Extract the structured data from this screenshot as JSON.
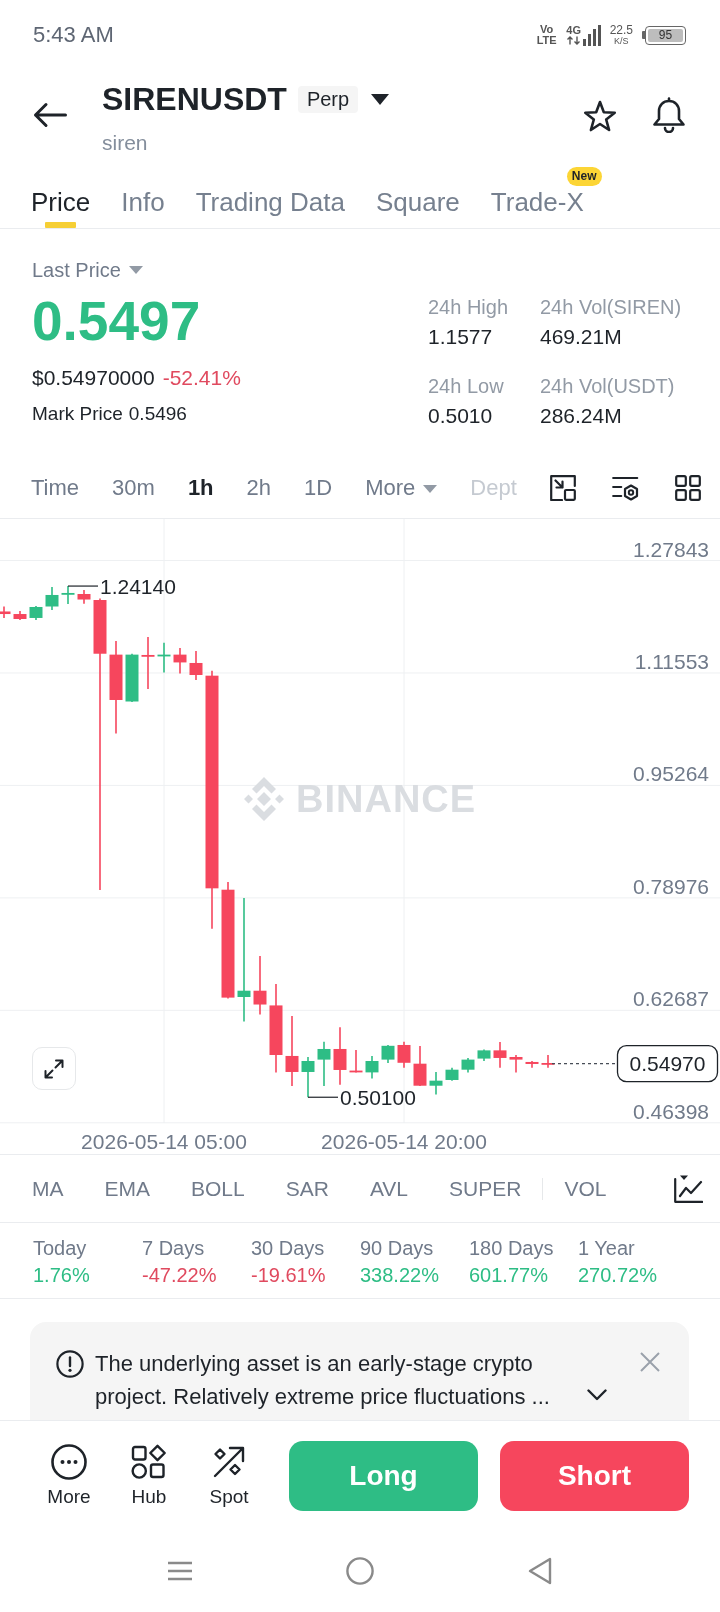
{
  "status_bar": {
    "time": "5:43 AM",
    "volte_top": "Vo",
    "volte_bottom": "LTE",
    "network": "4G",
    "speed": "22.5",
    "speed_unit": "K/S",
    "battery": "95"
  },
  "header": {
    "symbol": "SIRENUSDT",
    "contract": "Perp",
    "name": "siren"
  },
  "tabs": [
    {
      "label": "Price",
      "selected": true
    },
    {
      "label": "Info",
      "selected": false
    },
    {
      "label": "Trading Data",
      "selected": false
    },
    {
      "label": "Square",
      "selected": false
    },
    {
      "label": "Trade-X",
      "selected": false,
      "badge": "New"
    }
  ],
  "ticker": {
    "price_label": "Last Price",
    "last_price": "0.5497",
    "last_price_up": true,
    "usd_price": "$0.54970000",
    "change": "-52.41%",
    "change_up": false,
    "mark_label": "Mark Price",
    "mark_price": "0.5496"
  },
  "stats": [
    {
      "label": "24h High",
      "value": "1.1577"
    },
    {
      "label": "24h Vol(SIREN)",
      "value": "469.21M"
    },
    {
      "label": "24h Low",
      "value": "0.5010"
    },
    {
      "label": "24h Vol(USDT)",
      "value": "286.24M"
    }
  ],
  "intervals": [
    {
      "label": "Time",
      "selected": false
    },
    {
      "label": "30m",
      "selected": false
    },
    {
      "label": "1h",
      "selected": true
    },
    {
      "label": "2h",
      "selected": false
    },
    {
      "label": "1D",
      "selected": false
    }
  ],
  "more_menu": {
    "label": "More"
  },
  "depth_tab": {
    "label": "Dept"
  },
  "chart": {
    "watermark": "BINANCE",
    "chart_data": {
      "type": "candlestick",
      "categories": [
        null,
        null,
        null,
        null,
        null,
        null,
        null,
        null,
        null,
        null,
        "2026-05-14 05:00",
        null,
        null,
        null,
        null,
        null,
        null,
        null,
        null,
        null,
        null,
        null,
        null,
        null,
        null,
        "2026-05-14 20:00",
        null,
        null,
        null,
        null,
        null,
        null,
        null,
        null,
        null
      ],
      "ohlc": [
        [
          1.2046,
          1.2118,
          1.1952,
          1.2009
        ],
        [
          1.2009,
          1.2053,
          1.1923,
          1.1937
        ],
        [
          1.1952,
          1.2125,
          1.1923,
          1.2111
        ],
        [
          1.2118,
          1.24,
          1.2067,
          1.2285
        ],
        [
          1.2292,
          1.2414,
          1.2154,
          1.2314
        ],
        [
          1.2299,
          1.2357,
          1.2159,
          1.2219
        ],
        [
          1.2212,
          1.2233,
          0.8012,
          1.1434
        ],
        [
          1.1421,
          1.1618,
          1.0277,
          1.0764
        ],
        [
          1.0742,
          1.1434,
          1.0735,
          1.1421
        ],
        [
          1.1416,
          1.1676,
          1.0923,
          1.1394
        ],
        [
          1.1401,
          1.1594,
          1.1162,
          1.1421
        ],
        [
          1.1421,
          1.1517,
          1.1148,
          1.1308
        ],
        [
          1.13,
          1.1474,
          1.1054,
          1.1126
        ],
        [
          1.1116,
          1.1188,
          0.7451,
          0.8036
        ],
        [
          0.8016,
          0.8128,
          0.644,
          0.6453
        ],
        [
          0.6462,
          0.7896,
          0.6107,
          0.6553
        ],
        [
          0.6553,
          0.7056,
          0.6207,
          0.6353
        ],
        [
          0.634,
          0.665,
          0.537,
          0.5622
        ],
        [
          0.5608,
          0.6187,
          0.5173,
          0.5376
        ],
        [
          0.5376,
          0.5593,
          0.501,
          0.5535
        ],
        [
          0.5555,
          0.5815,
          0.5173,
          0.5709
        ],
        [
          0.5709,
          0.6022,
          0.519,
          0.5405
        ],
        [
          0.5396,
          0.5694,
          0.537,
          0.537
        ],
        [
          0.537,
          0.5608,
          0.5283,
          0.5535
        ],
        [
          0.5555,
          0.5767,
          0.5506,
          0.5755
        ],
        [
          0.5767,
          0.5815,
          0.5437,
          0.5509
        ],
        [
          0.5496,
          0.5752,
          0.5173,
          0.5177
        ],
        [
          0.5177,
          0.5376,
          0.505,
          0.525
        ],
        [
          0.526,
          0.5437,
          0.525,
          0.5409
        ],
        [
          0.5409,
          0.5579,
          0.537,
          0.5555
        ],
        [
          0.557,
          0.5702,
          0.5535,
          0.5689
        ],
        [
          0.5689,
          0.581,
          0.5437,
          0.5579
        ],
        [
          0.5593,
          0.5622,
          0.537,
          0.5555
        ],
        [
          0.5521,
          0.5535,
          0.5437,
          0.5492
        ],
        [
          0.5506,
          0.5622,
          0.5437,
          0.5497
        ]
      ],
      "ylim": [
        0.46398,
        1.33854
      ],
      "yticks": [
        1.27843,
        1.11553,
        0.95264,
        0.78976,
        0.62687,
        0.46398
      ],
      "grid": true,
      "annotations": [
        "1.24140",
        "0.50100",
        "0.54970"
      ]
    }
  },
  "indicators": {
    "main": [
      "MA",
      "EMA",
      "BOLL",
      "SAR",
      "AVL",
      "SUPER"
    ],
    "sub": [
      "VOL"
    ]
  },
  "returns": [
    {
      "period": "Today",
      "value": "1.76%",
      "up": true
    },
    {
      "period": "7 Days",
      "value": "-47.22%",
      "up": false
    },
    {
      "period": "30 Days",
      "value": "-19.61%",
      "up": false
    },
    {
      "period": "90 Days",
      "value": "338.22%",
      "up": true
    },
    {
      "period": "180 Days",
      "value": "601.77%",
      "up": true
    },
    {
      "period": "1 Year",
      "value": "270.72%",
      "up": true
    }
  ],
  "notice": {
    "text": "The underlying asset is an early-stage crypto project. Relatively extreme price fluctuations ..."
  },
  "actions": [
    {
      "label": "More"
    },
    {
      "label": "Hub"
    },
    {
      "label": "Spot"
    }
  ],
  "trade_buttons": [
    {
      "label": "Long",
      "kind": "buy"
    },
    {
      "label": "Short",
      "kind": "sell"
    }
  ]
}
